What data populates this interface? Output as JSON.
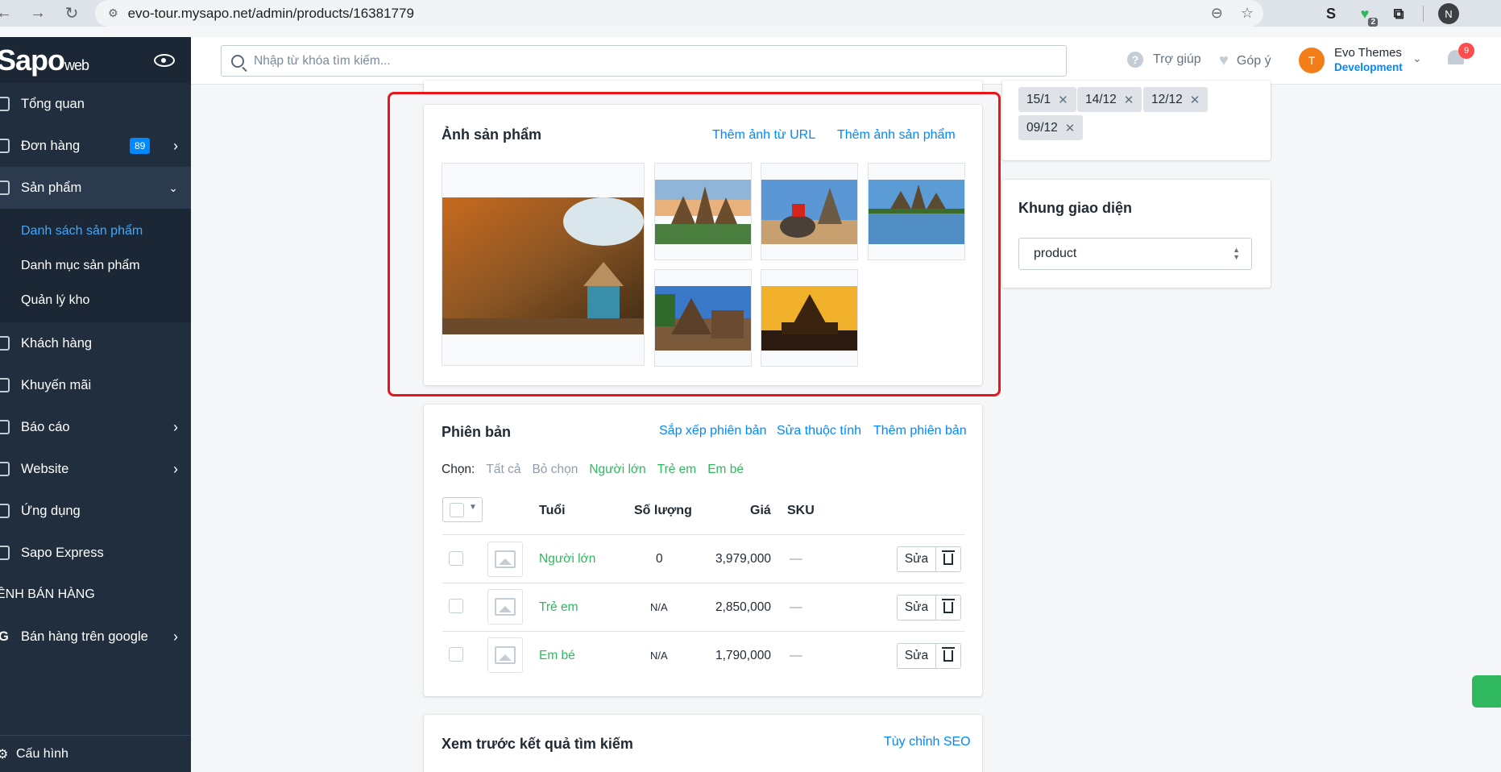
{
  "browser": {
    "url": "evo-tour.mysapo.net/admin/products/16381779",
    "ext_badge": "2",
    "profile_initial": "N"
  },
  "sidebar": {
    "logo": "Sapo",
    "logo_suffix": "web",
    "items": [
      {
        "label": "Tổng quan"
      },
      {
        "label": "Đơn hàng",
        "badge": "89"
      },
      {
        "label": "Sản phẩm"
      },
      {
        "label": "Khách hàng"
      },
      {
        "label": "Khuyến mãi"
      },
      {
        "label": "Báo cáo"
      },
      {
        "label": "Website"
      },
      {
        "label": "Ứng dụng"
      },
      {
        "label": "Sapo Express"
      }
    ],
    "subitems": [
      "Danh sách sản phẩm",
      "Danh mục sản phẩm",
      "Quản lý kho"
    ],
    "section_title": "ÊNH BÁN HÀNG",
    "google_item": "Bán hàng trên google",
    "bottom": "Cấu hình"
  },
  "header": {
    "search_placeholder": "Nhập từ khóa tìm kiếm...",
    "help": "Trợ giúp",
    "feedback": "Góp ý",
    "user_initial": "T",
    "user_name": "Evo Themes",
    "user_store": "Development",
    "notif_count": "9"
  },
  "images_card": {
    "title": "Ảnh sản phẩm",
    "add_url": "Thêm ảnh từ URL",
    "add_image": "Thêm ảnh sản phẩm"
  },
  "tags": [
    "15/1",
    "14/12",
    "12/12",
    "09/12"
  ],
  "layout_card": {
    "title": "Khung giao diện",
    "value": "product"
  },
  "variants": {
    "title": "Phiên bản",
    "sort": "Sắp xếp phiên bản",
    "edit_attr": "Sửa thuộc tính",
    "add": "Thêm phiên bản",
    "filter_label": "Chọn:",
    "filter_all": "Tất cả",
    "filter_none": "Bỏ chọn",
    "filters": [
      "Người lớn",
      "Trẻ em",
      "Em bé"
    ],
    "columns": [
      "Tuổi",
      "Số lượng",
      "Giá",
      "SKU"
    ],
    "rows": [
      {
        "name": "Người lớn",
        "qty": "0",
        "price": "3,979,000",
        "sku": "—"
      },
      {
        "name": "Trẻ em",
        "qty": "N/A",
        "price": "2,850,000",
        "sku": "—"
      },
      {
        "name": "Em bé",
        "qty": "N/A",
        "price": "1,790,000",
        "sku": "—"
      }
    ],
    "edit_label": "Sửa"
  },
  "seo_card": {
    "title": "Xem trước kết quả tìm kiếm",
    "link": "Tùy chỉnh SEO"
  }
}
